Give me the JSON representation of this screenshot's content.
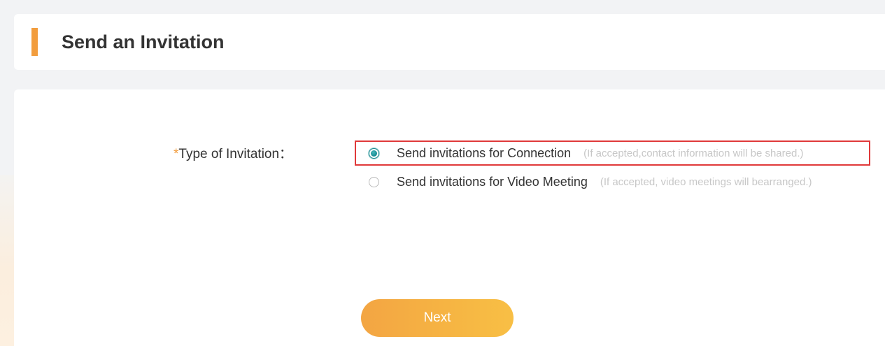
{
  "header": {
    "title": "Send an Invitation"
  },
  "form": {
    "required_mark": "*",
    "type_label": "Type of Invitation：",
    "options": [
      {
        "label": "Send invitations for Connection",
        "hint": "(If accepted,contact information will be shared.)",
        "selected": true
      },
      {
        "label": "Send invitations for Video Meeting",
        "hint": "(If accepted, video meetings will bearranged.)",
        "selected": false
      }
    ],
    "next_label": "Next"
  },
  "colors": {
    "accent": "#f29d3e",
    "selection_highlight": "#e0393a",
    "radio_checked": "#138a90",
    "hint_text": "#c7c7c7"
  }
}
